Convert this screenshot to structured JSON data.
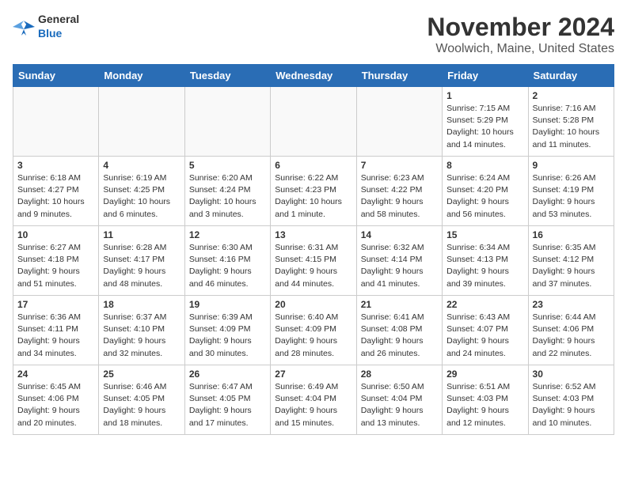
{
  "header": {
    "logo_general": "General",
    "logo_blue": "Blue",
    "month": "November 2024",
    "location": "Woolwich, Maine, United States"
  },
  "weekdays": [
    "Sunday",
    "Monday",
    "Tuesday",
    "Wednesday",
    "Thursday",
    "Friday",
    "Saturday"
  ],
  "weeks": [
    [
      {
        "day": "",
        "detail": ""
      },
      {
        "day": "",
        "detail": ""
      },
      {
        "day": "",
        "detail": ""
      },
      {
        "day": "",
        "detail": ""
      },
      {
        "day": "",
        "detail": ""
      },
      {
        "day": "1",
        "detail": "Sunrise: 7:15 AM\nSunset: 5:29 PM\nDaylight: 10 hours\nand 14 minutes."
      },
      {
        "day": "2",
        "detail": "Sunrise: 7:16 AM\nSunset: 5:28 PM\nDaylight: 10 hours\nand 11 minutes."
      }
    ],
    [
      {
        "day": "3",
        "detail": "Sunrise: 6:18 AM\nSunset: 4:27 PM\nDaylight: 10 hours\nand 9 minutes."
      },
      {
        "day": "4",
        "detail": "Sunrise: 6:19 AM\nSunset: 4:25 PM\nDaylight: 10 hours\nand 6 minutes."
      },
      {
        "day": "5",
        "detail": "Sunrise: 6:20 AM\nSunset: 4:24 PM\nDaylight: 10 hours\nand 3 minutes."
      },
      {
        "day": "6",
        "detail": "Sunrise: 6:22 AM\nSunset: 4:23 PM\nDaylight: 10 hours\nand 1 minute."
      },
      {
        "day": "7",
        "detail": "Sunrise: 6:23 AM\nSunset: 4:22 PM\nDaylight: 9 hours\nand 58 minutes."
      },
      {
        "day": "8",
        "detail": "Sunrise: 6:24 AM\nSunset: 4:20 PM\nDaylight: 9 hours\nand 56 minutes."
      },
      {
        "day": "9",
        "detail": "Sunrise: 6:26 AM\nSunset: 4:19 PM\nDaylight: 9 hours\nand 53 minutes."
      }
    ],
    [
      {
        "day": "10",
        "detail": "Sunrise: 6:27 AM\nSunset: 4:18 PM\nDaylight: 9 hours\nand 51 minutes."
      },
      {
        "day": "11",
        "detail": "Sunrise: 6:28 AM\nSunset: 4:17 PM\nDaylight: 9 hours\nand 48 minutes."
      },
      {
        "day": "12",
        "detail": "Sunrise: 6:30 AM\nSunset: 4:16 PM\nDaylight: 9 hours\nand 46 minutes."
      },
      {
        "day": "13",
        "detail": "Sunrise: 6:31 AM\nSunset: 4:15 PM\nDaylight: 9 hours\nand 44 minutes."
      },
      {
        "day": "14",
        "detail": "Sunrise: 6:32 AM\nSunset: 4:14 PM\nDaylight: 9 hours\nand 41 minutes."
      },
      {
        "day": "15",
        "detail": "Sunrise: 6:34 AM\nSunset: 4:13 PM\nDaylight: 9 hours\nand 39 minutes."
      },
      {
        "day": "16",
        "detail": "Sunrise: 6:35 AM\nSunset: 4:12 PM\nDaylight: 9 hours\nand 37 minutes."
      }
    ],
    [
      {
        "day": "17",
        "detail": "Sunrise: 6:36 AM\nSunset: 4:11 PM\nDaylight: 9 hours\nand 34 minutes."
      },
      {
        "day": "18",
        "detail": "Sunrise: 6:37 AM\nSunset: 4:10 PM\nDaylight: 9 hours\nand 32 minutes."
      },
      {
        "day": "19",
        "detail": "Sunrise: 6:39 AM\nSunset: 4:09 PM\nDaylight: 9 hours\nand 30 minutes."
      },
      {
        "day": "20",
        "detail": "Sunrise: 6:40 AM\nSunset: 4:09 PM\nDaylight: 9 hours\nand 28 minutes."
      },
      {
        "day": "21",
        "detail": "Sunrise: 6:41 AM\nSunset: 4:08 PM\nDaylight: 9 hours\nand 26 minutes."
      },
      {
        "day": "22",
        "detail": "Sunrise: 6:43 AM\nSunset: 4:07 PM\nDaylight: 9 hours\nand 24 minutes."
      },
      {
        "day": "23",
        "detail": "Sunrise: 6:44 AM\nSunset: 4:06 PM\nDaylight: 9 hours\nand 22 minutes."
      }
    ],
    [
      {
        "day": "24",
        "detail": "Sunrise: 6:45 AM\nSunset: 4:06 PM\nDaylight: 9 hours\nand 20 minutes."
      },
      {
        "day": "25",
        "detail": "Sunrise: 6:46 AM\nSunset: 4:05 PM\nDaylight: 9 hours\nand 18 minutes."
      },
      {
        "day": "26",
        "detail": "Sunrise: 6:47 AM\nSunset: 4:05 PM\nDaylight: 9 hours\nand 17 minutes."
      },
      {
        "day": "27",
        "detail": "Sunrise: 6:49 AM\nSunset: 4:04 PM\nDaylight: 9 hours\nand 15 minutes."
      },
      {
        "day": "28",
        "detail": "Sunrise: 6:50 AM\nSunset: 4:04 PM\nDaylight: 9 hours\nand 13 minutes."
      },
      {
        "day": "29",
        "detail": "Sunrise: 6:51 AM\nSunset: 4:03 PM\nDaylight: 9 hours\nand 12 minutes."
      },
      {
        "day": "30",
        "detail": "Sunrise: 6:52 AM\nSunset: 4:03 PM\nDaylight: 9 hours\nand 10 minutes."
      }
    ]
  ]
}
